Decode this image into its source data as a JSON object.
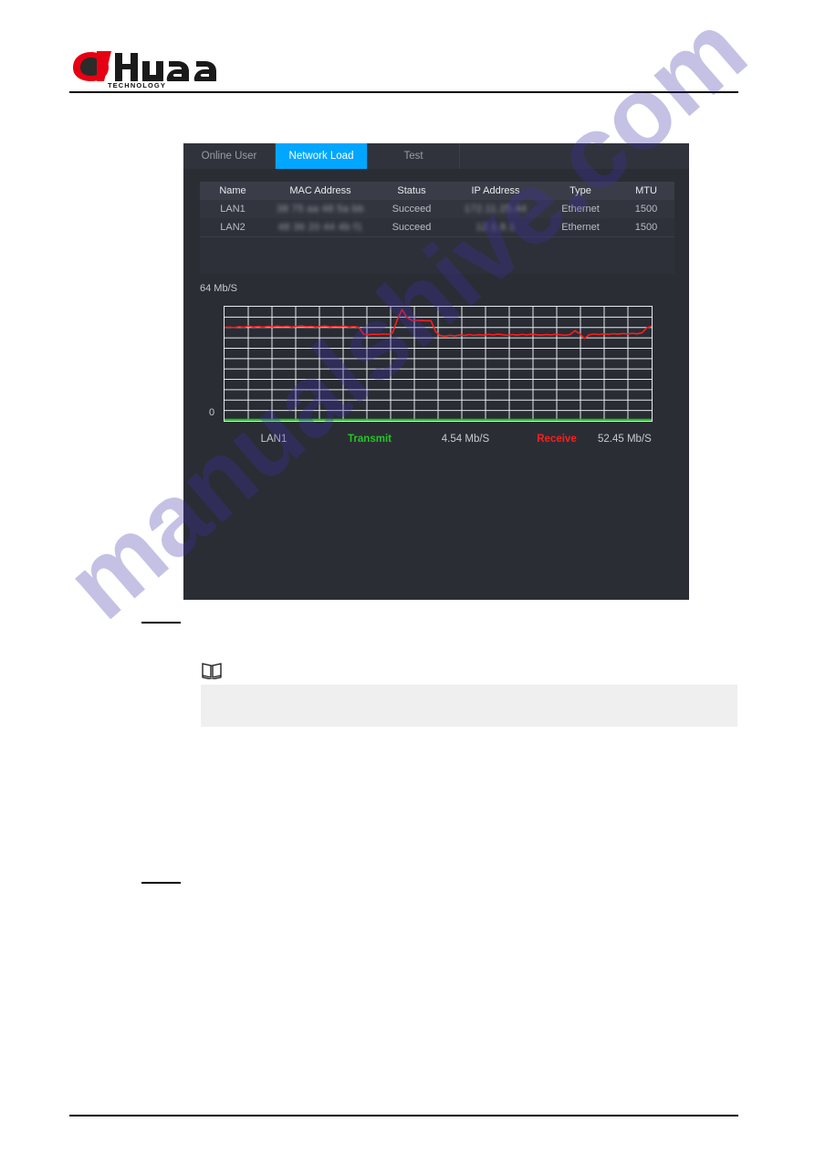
{
  "document": {
    "brand": {
      "name": "alhua",
      "tagline": "TECHNOLOGY",
      "mark_color": "#E60012",
      "text_color": "#111111"
    },
    "watermark_text": "manualshive.com",
    "note_icon": "book-note-icon",
    "note_text": ""
  },
  "device_ui": {
    "tabs": [
      {
        "label": "Online User",
        "active": false
      },
      {
        "label": "Network Load",
        "active": true
      },
      {
        "label": "Test",
        "active": false
      }
    ],
    "active_tab_color": "#00A6FF",
    "table": {
      "columns": [
        "Name",
        "MAC Address",
        "Status",
        "IP Address",
        "Type",
        "MTU"
      ],
      "rows": [
        {
          "name": "LAN1",
          "mac": "38 75 aa 48 5a bb",
          "status": "Succeed",
          "ip": "172.11.25.44",
          "type": "Ethernet",
          "mtu": "1500"
        },
        {
          "name": "LAN2",
          "mac": "48 36 20 44 4b f1",
          "status": "Succeed",
          "ip": "12.1.8.1",
          "type": "Ethernet",
          "mtu": "1500"
        }
      ]
    },
    "chart_legend": {
      "interface": "LAN1",
      "transmit_label": "Transmit",
      "transmit_value": "4.54 Mb/S",
      "transmit_color": "#22C822",
      "receive_label": "Receive",
      "receive_value": "52.45 Mb/S",
      "receive_color": "#FF1D1D"
    }
  },
  "chart_data": {
    "type": "line",
    "title": "Network Load",
    "xlabel": "",
    "ylabel": "Mb/S",
    "ylim": [
      0,
      64
    ],
    "y_tick_labels": [
      "64 Mb/S",
      "0"
    ],
    "grid": true,
    "grid_columns": 18,
    "grid_rows": 11,
    "legend_position": "bottom",
    "series": [
      {
        "name": "Receive",
        "color": "#FF1D1D",
        "unit": "Mb/S",
        "current_value": 52.45,
        "values": [
          52.4,
          52.6,
          52.3,
          52.8,
          52.5,
          53.1,
          52.6,
          52.9,
          52.5,
          53.0,
          52.7,
          53.2,
          52.8,
          53.1,
          52.6,
          52.9,
          53.3,
          52.8,
          53.0,
          52.6,
          52.9,
          53.2,
          52.7,
          53.0,
          52.8,
          53.1,
          52.6,
          52.9,
          52.4,
          48.5,
          48.3,
          48.6,
          48.4,
          48.7,
          48.5,
          49.2,
          56.8,
          62.4,
          58.1,
          56.4,
          56.2,
          56.3,
          56.1,
          56.2,
          50.0,
          47.8,
          47.5,
          48.0,
          47.6,
          48.2,
          47.9,
          48.4,
          48.0,
          48.3,
          48.1,
          48.5,
          48.2,
          48.6,
          48.3,
          48.0,
          48.4,
          48.1,
          48.5,
          48.2,
          48.6,
          48.3,
          48.1,
          48.4,
          48.2,
          48.5,
          48.3,
          48.0,
          48.4,
          50.6,
          48.9,
          46.2,
          48.3,
          48.7,
          48.4,
          48.8,
          48.5,
          48.9,
          48.6,
          49.0,
          48.7,
          49.1,
          48.8,
          49.4,
          52.2,
          53.0
        ]
      },
      {
        "name": "Transmit",
        "color": "#22C822",
        "unit": "Mb/S",
        "current_value": 4.54,
        "values": [
          0.6,
          0.6,
          0.6,
          0.6,
          0.6,
          0.6,
          0.6,
          0.6,
          0.6,
          0.6,
          0.6,
          0.6,
          0.6,
          0.6,
          0.6,
          0.6,
          0.6,
          0.6,
          0.6,
          0.6,
          0.6,
          0.6,
          0.6,
          0.6,
          0.6,
          0.6,
          0.6,
          0.6,
          0.6,
          0.6,
          0.6,
          0.6,
          0.6,
          0.6,
          0.6,
          0.6,
          0.6,
          0.6,
          0.6,
          0.6,
          0.6,
          0.6,
          0.6,
          0.6,
          0.6,
          0.6,
          0.6,
          0.6,
          0.6,
          0.6,
          0.6,
          0.6,
          0.6,
          0.6,
          0.6,
          0.6,
          0.6,
          0.6,
          0.6,
          0.6,
          0.6,
          0.6,
          0.6,
          0.6,
          0.6,
          0.6,
          0.6,
          0.6,
          0.6,
          0.6,
          0.6,
          0.6,
          0.6,
          0.6,
          0.6,
          0.6,
          0.6,
          0.6,
          0.6,
          0.6,
          0.6,
          0.6,
          0.6,
          0.6,
          0.6,
          0.6,
          0.6,
          0.6,
          0.6,
          0.6
        ]
      }
    ]
  }
}
